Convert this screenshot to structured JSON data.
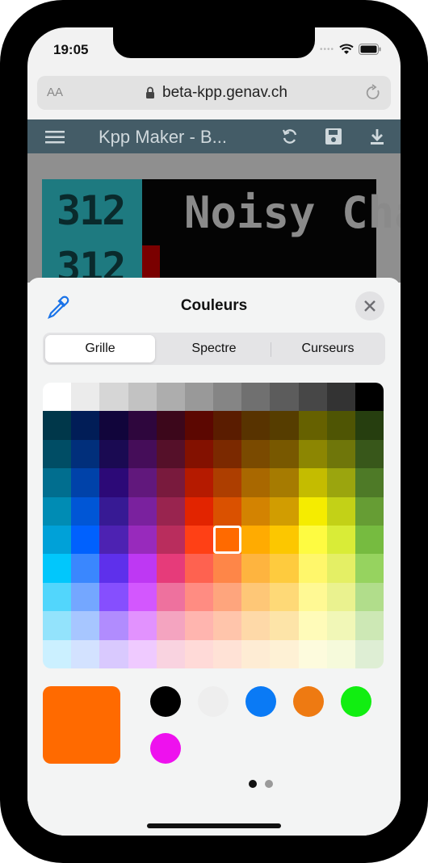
{
  "status": {
    "time": "19:05"
  },
  "browser": {
    "aa_label": "AA",
    "url": "beta-kpp.genav.ch"
  },
  "app": {
    "title": "Kpp Maker - B..."
  },
  "led": {
    "number": "312",
    "number_second": "312",
    "title": "Noisy Cha"
  },
  "picker": {
    "title": "Couleurs",
    "tabs": [
      {
        "label": "Grille",
        "active": true
      },
      {
        "label": "Spectre",
        "active": false
      },
      {
        "label": "Curseurs",
        "active": false
      }
    ],
    "selected_color": "#ff6a00",
    "selected_cell": {
      "row": 5,
      "col": 6
    },
    "grid_rows": [
      [
        "#ffffff",
        "#ebebeb",
        "#d6d6d6",
        "#c2c2c2",
        "#adadad",
        "#999999",
        "#858585",
        "#707070",
        "#5c5c5c",
        "#474747",
        "#333333",
        "#000000"
      ],
      [
        "#00374a",
        "#011d57",
        "#11053b",
        "#2e063d",
        "#3c071b",
        "#5c0701",
        "#5a1c00",
        "#583300",
        "#563d00",
        "#666100",
        "#4f5504",
        "#263e0f"
      ],
      [
        "#004d65",
        "#012f7b",
        "#1a0a52",
        "#450d59",
        "#551029",
        "#831100",
        "#7b2900",
        "#7a4a00",
        "#785800",
        "#8c8602",
        "#6f760a",
        "#38571a"
      ],
      [
        "#016e8f",
        "#0042a9",
        "#2c0977",
        "#61187c",
        "#791a3d",
        "#b51a00",
        "#ad3e00",
        "#a96800",
        "#a67b01",
        "#c4bc00",
        "#9ba50e",
        "#4e7a27"
      ],
      [
        "#008cb4",
        "#0056d6",
        "#371a94",
        "#7a219e",
        "#99244f",
        "#e22400",
        "#da5100",
        "#d38301",
        "#d19d01",
        "#f5ec00",
        "#c3d117",
        "#669d34"
      ],
      [
        "#00a1d8",
        "#0061fe",
        "#4d22b2",
        "#982abc",
        "#b92d5d",
        "#ff4015",
        "#ff6a00",
        "#ffab01",
        "#fcc700",
        "#fefb41",
        "#d9ec37",
        "#76bb40"
      ],
      [
        "#01c7fc",
        "#3a87fe",
        "#5e30eb",
        "#be38f3",
        "#e63b7a",
        "#fe6250",
        "#fe8648",
        "#feb43f",
        "#fecb3e",
        "#fff76b",
        "#e4ef65",
        "#96d35f"
      ],
      [
        "#52d6fc",
        "#74a7ff",
        "#864ffe",
        "#d357fe",
        "#ee719e",
        "#ff8c82",
        "#fea57d",
        "#fec777",
        "#fed977",
        "#fff994",
        "#eaf28f",
        "#b1dd8b"
      ],
      [
        "#93e3fc",
        "#a7c6ff",
        "#b18cfe",
        "#e292fe",
        "#f4a4c0",
        "#ffb5af",
        "#ffc5ab",
        "#fed9a8",
        "#fde4a8",
        "#fffbb9",
        "#f1f7b7",
        "#cde8b5"
      ],
      [
        "#cbf0ff",
        "#d3e2ff",
        "#d9c9fe",
        "#efcaff",
        "#f9d3e0",
        "#ffdad8",
        "#ffe2d6",
        "#feecd4",
        "#fef1d5",
        "#fdfbdd",
        "#f6fadb",
        "#deeed4"
      ]
    ],
    "current_color": "#ff6a00",
    "saved_colors": [
      "#000000",
      "#eeeeee",
      "#0a7af5",
      "#ee7a12",
      "#11ee11",
      "#ee11ee"
    ],
    "page_dots": [
      true,
      false
    ]
  }
}
